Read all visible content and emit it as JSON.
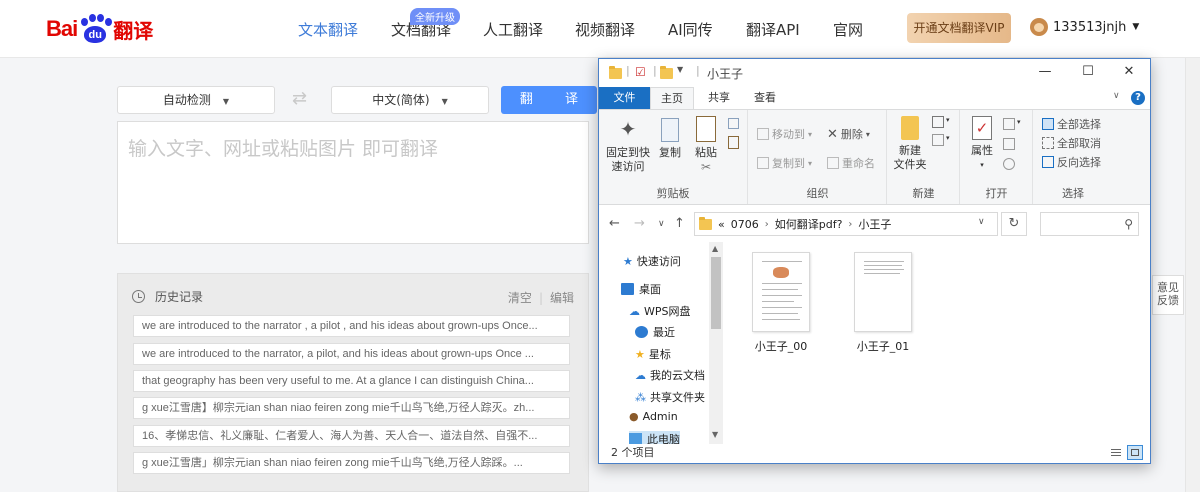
{
  "logo": {
    "bai": "Bai",
    "du": "du",
    "fanyi": "翻译"
  },
  "nav": {
    "items": [
      "文本翻译",
      "文档翻译",
      "人工翻译",
      "视频翻译",
      "AI同传",
      "翻译API",
      "官网"
    ],
    "badge": "全新升级",
    "vip": "开通文档翻译VIP",
    "username": "133513jnjh"
  },
  "translator": {
    "source_lang": "自动检测",
    "target_lang": "中文(简体)",
    "translate_label": "翻 译",
    "placeholder": "输入文字、网址或粘贴图片 即可翻译"
  },
  "history": {
    "title": "历史记录",
    "clear": "清空",
    "edit": "编辑",
    "items": [
      "we are introduced to the narrator , a pilot , and his ideas about grown-ups Once...",
      "we are introduced to the narrator, a pilot, and his ideas about grown-ups Once ...",
      "that geography has been very useful to me. At a glance I can distinguish China...",
      "g xue江雪唐】柳宗元ian shan niao feiren zong mie千山鸟飞绝,万径人踪灭。zh...",
      "16、孝悌忠信、礼义廉耻、仁者爱人、海人为善、天人合一、道法自然、自强不...",
      "g xue江雪唐」柳宗元ian shan niao feiren zong mie千山鸟飞绝,万径人踪踩。..."
    ]
  },
  "feedback": {
    "line1": "意见",
    "line2": "反馈"
  },
  "explorer": {
    "title": "小王子",
    "window_controls": {
      "minimize": "—",
      "maximize": "☐",
      "close": "✕"
    },
    "tabs": [
      "文件",
      "主页",
      "共享",
      "查看"
    ],
    "ribbon": {
      "clipboard": {
        "label": "剪贴板",
        "pin": "固定到快\n速访问",
        "copy": "复制",
        "paste": "粘贴"
      },
      "organize": {
        "label": "组织",
        "move_to": "移动到",
        "copy_to": "复制到",
        "delete": "删除",
        "rename": "重命名"
      },
      "new": {
        "label": "新建",
        "new_folder": "新建\n文件夹"
      },
      "open": {
        "label": "打开",
        "properties": "属性"
      },
      "select": {
        "label": "选择",
        "select_all": "全部选择",
        "select_none": "全部取消",
        "invert": "反向选择"
      }
    },
    "address": {
      "prefix": "«",
      "crumbs": [
        "0706",
        "如何翻译pdf?",
        "小王子"
      ]
    },
    "nav_pane": [
      "快速访问",
      "桌面",
      "WPS网盘",
      "最近",
      "星标",
      "我的云文档",
      "共享文件夹",
      "Admin",
      "此电脑"
    ],
    "files": [
      "小王子_00",
      "小王子_01"
    ],
    "status": "2 个项目"
  },
  "colors": {
    "accent": "#4d90fe",
    "brand_red": "#e10602",
    "brand_blue": "#2932e1",
    "explorer_blue": "#1a6fc3"
  }
}
